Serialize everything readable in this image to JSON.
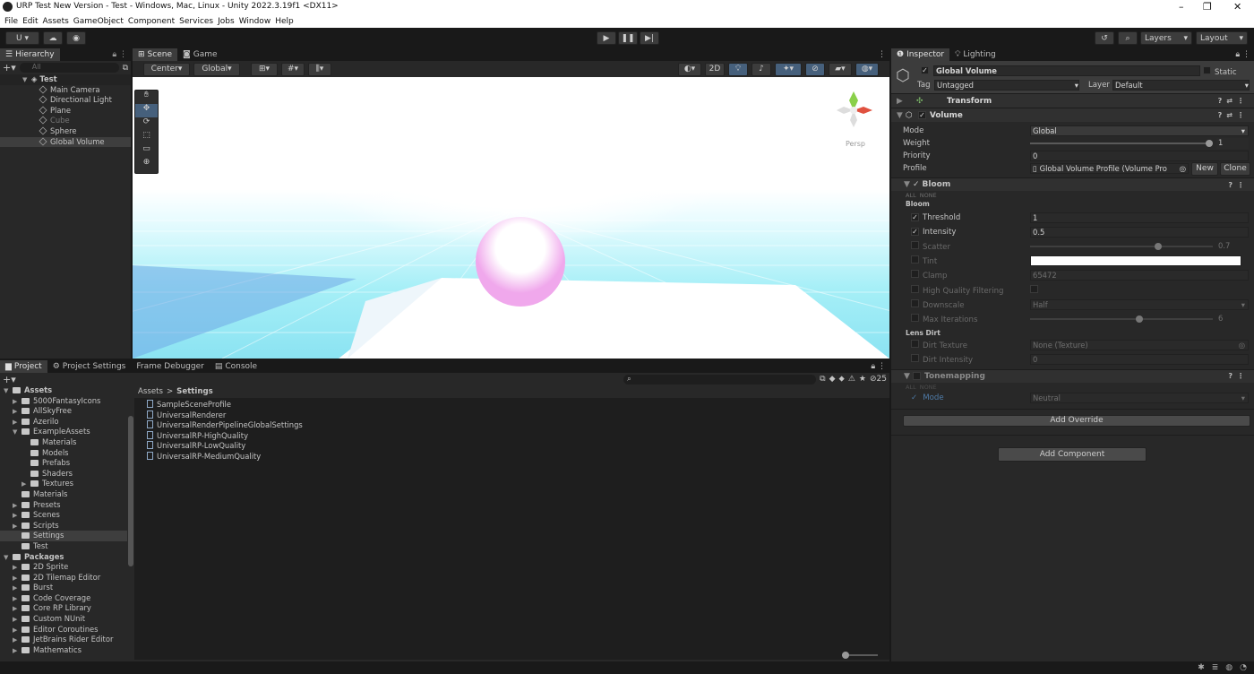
{
  "title_bar": {
    "title": "URP Test New Version - Test - Windows, Mac, Linux - Unity 2022.3.19f1 <DX11>",
    "minimize": "–",
    "maximize": "❐",
    "close": "✕"
  },
  "menu": [
    "File",
    "Edit",
    "Assets",
    "GameObject",
    "Component",
    "Services",
    "Jobs",
    "Window",
    "Help"
  ],
  "toolbar": {
    "account": "U ▾",
    "layers": "Layers",
    "layout": "Layout"
  },
  "hierarchy": {
    "tab": "Hierarchy",
    "search_placeholder": "All",
    "scene": "Test",
    "items": [
      "Main Camera",
      "Directional Light",
      "Plane",
      "Cube",
      "Sphere",
      "Global Volume"
    ]
  },
  "scene": {
    "tabs": [
      "Scene",
      "Game"
    ],
    "pivot": "Center",
    "space": "Global",
    "mode_2d": "2D",
    "persp": "Persp"
  },
  "project": {
    "tabs": [
      "Project",
      "Project Settings",
      "Frame Debugger",
      "Console"
    ],
    "count": "25",
    "breadcrumb": [
      "Assets",
      "Settings"
    ],
    "tree": [
      {
        "label": "Assets",
        "level": 0,
        "bold": true,
        "fold": "▼"
      },
      {
        "label": "5000FantasyIcons",
        "level": 1,
        "fold": "▶"
      },
      {
        "label": "AllSkyFree",
        "level": 1,
        "fold": "▶"
      },
      {
        "label": "Azerilo",
        "level": 1,
        "fold": "▶"
      },
      {
        "label": "ExampleAssets",
        "level": 1,
        "fold": "▼"
      },
      {
        "label": "Materials",
        "level": 2,
        "fold": ""
      },
      {
        "label": "Models",
        "level": 2,
        "fold": ""
      },
      {
        "label": "Prefabs",
        "level": 2,
        "fold": ""
      },
      {
        "label": "Shaders",
        "level": 2,
        "fold": ""
      },
      {
        "label": "Textures",
        "level": 2,
        "fold": "▶"
      },
      {
        "label": "Materials",
        "level": 1,
        "fold": ""
      },
      {
        "label": "Presets",
        "level": 1,
        "fold": "▶"
      },
      {
        "label": "Scenes",
        "level": 1,
        "fold": "▶"
      },
      {
        "label": "Scripts",
        "level": 1,
        "fold": "▶"
      },
      {
        "label": "Settings",
        "level": 1,
        "fold": "",
        "selected": true
      },
      {
        "label": "Test",
        "level": 1,
        "fold": ""
      },
      {
        "label": "Packages",
        "level": 0,
        "bold": true,
        "fold": "▼"
      },
      {
        "label": "2D Sprite",
        "level": 1,
        "fold": "▶"
      },
      {
        "label": "2D Tilemap Editor",
        "level": 1,
        "fold": "▶"
      },
      {
        "label": "Burst",
        "level": 1,
        "fold": "▶"
      },
      {
        "label": "Code Coverage",
        "level": 1,
        "fold": "▶"
      },
      {
        "label": "Core RP Library",
        "level": 1,
        "fold": "▶"
      },
      {
        "label": "Custom NUnit",
        "level": 1,
        "fold": "▶"
      },
      {
        "label": "Editor Coroutines",
        "level": 1,
        "fold": "▶"
      },
      {
        "label": "JetBrains Rider Editor",
        "level": 1,
        "fold": "▶"
      },
      {
        "label": "Mathematics",
        "level": 1,
        "fold": "▶"
      }
    ],
    "files": [
      "SampleSceneProfile",
      "UniversalRenderer",
      "UniversalRenderPipelineGlobalSettings",
      "UniversalRP-HighQuality",
      "UniversalRP-LowQuality",
      "UniversalRP-MediumQuality"
    ]
  },
  "inspector": {
    "tabs": [
      "Inspector",
      "Lighting"
    ],
    "object_name": "Global Volume",
    "static": "Static",
    "tag_label": "Tag",
    "tag": "Untagged",
    "layer_label": "Layer",
    "layer": "Default",
    "transform": "Transform",
    "volume": "Volume",
    "volume_fields": {
      "mode_label": "Mode",
      "mode": "Global",
      "weight_label": "Weight",
      "weight": "1",
      "priority_label": "Priority",
      "priority": "0",
      "profile_label": "Profile",
      "profile": "Global Volume Profile (Volume Pro",
      "new": "New",
      "clone": "Clone"
    },
    "bloom": {
      "title": "Bloom",
      "all": "ALL",
      "none": "NONE",
      "group": "Bloom",
      "rows": [
        {
          "label": "Threshold",
          "value": "1",
          "on": true,
          "kind": "field"
        },
        {
          "label": "Intensity",
          "value": "0.5",
          "on": true,
          "kind": "field"
        },
        {
          "label": "Scatter",
          "value": "0.7",
          "on": false,
          "kind": "slider",
          "level": 0.7
        },
        {
          "label": "Tint",
          "value": "",
          "on": false,
          "kind": "color"
        },
        {
          "label": "Clamp",
          "value": "65472",
          "on": false,
          "kind": "field"
        },
        {
          "label": "High Quality Filtering",
          "value": "",
          "on": false,
          "kind": "check"
        },
        {
          "label": "Downscale",
          "value": "Half",
          "on": false,
          "kind": "dropdown"
        },
        {
          "label": "Max Iterations",
          "value": "6",
          "on": false,
          "kind": "slider",
          "level": 0.6
        }
      ],
      "lens_dirt": "Lens Dirt",
      "dirt_rows": [
        {
          "label": "Dirt Texture",
          "value": "None (Texture)"
        },
        {
          "label": "Dirt Intensity",
          "value": "0"
        }
      ]
    },
    "tonemapping": {
      "title": "Tonemapping",
      "all": "ALL",
      "none": "NONE",
      "mode_label": "Mode",
      "mode": "Neutral"
    },
    "add_override": "Add Override",
    "add_component": "Add Component"
  },
  "colors": {
    "accent": "#2c5d87",
    "panel": "#282828",
    "dark": "#191919"
  }
}
